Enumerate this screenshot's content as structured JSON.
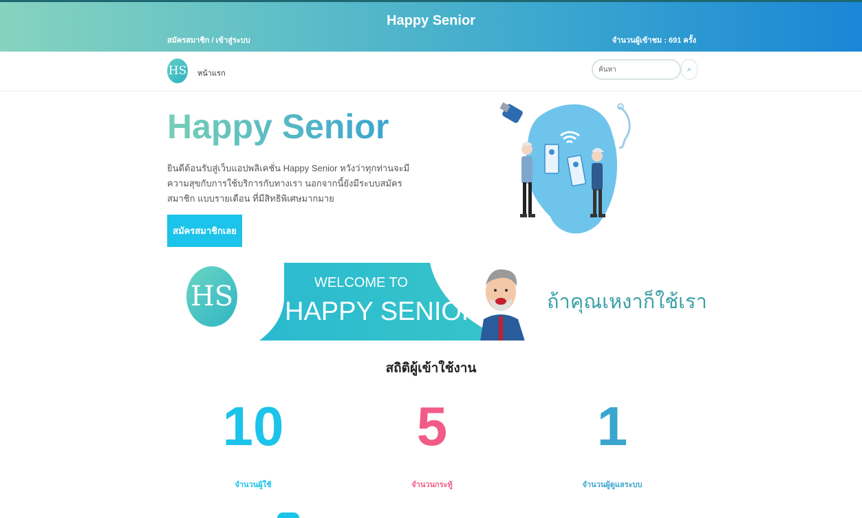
{
  "header": {
    "site_title": "Happy Senior",
    "auth_link": "สมัครสมาชิก / เข้าสู่ระบบ",
    "visitor_count": "จำนวนผู้เข้าชม : 691 ครั้ง"
  },
  "nav": {
    "logo_text": "HS",
    "home_label": "หน้าแรก",
    "search_placeholder": "ค้นหา",
    "search_button_glyph": "⌕"
  },
  "hero": {
    "title": "Happy Senior",
    "description": "ยินดีต้อนรับสู่เว็บแอปพลิเคชั่น Happy Senior หวังว่าทุกท่านจะมีความสุขกับการใช้บริการกับทางเรา นอกจากนี้ยังมีระบบสมัครสมาชิก แบบรายเดือน ที่มีสิทธิพิเศษมากมาย",
    "cta_label": "สมัครสมาชิกเลย"
  },
  "banner": {
    "logo_text": "HS",
    "welcome_text": "WELCOME TO",
    "name_text": "HAPPY SENIOR",
    "slogan": "ถ้าคุณเหงาก็ใช้เรา"
  },
  "stats": {
    "title": "สถิติผู้เข้าใช้งาน",
    "items": [
      {
        "value": "10",
        "label": "จำนวนผู้ใช้",
        "color": "#1cc3ea"
      },
      {
        "value": "5",
        "label": "จำนวนกระทู้",
        "color": "#f25b87"
      },
      {
        "value": "1",
        "label": "จำนวนผู้ดูแลระบบ",
        "color": "#3aa6cf"
      }
    ]
  },
  "colors": {
    "accent": "#1cc3ea",
    "header_gradient_start": "#86d3bf",
    "header_gradient_end": "#1a86d6",
    "pink": "#f25b87"
  }
}
